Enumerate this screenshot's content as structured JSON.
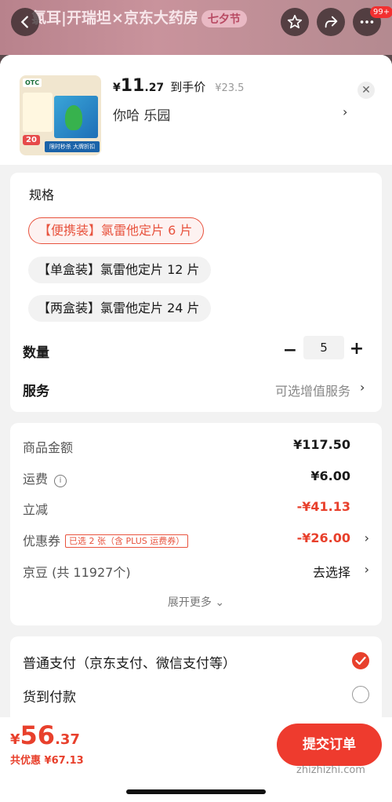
{
  "banner": {
    "text": "氯耳|开瑞坦×京东大药房",
    "badge": "七夕节",
    "notif_count": "99+"
  },
  "product": {
    "thumb": {
      "otc": "OTC",
      "promo_num": "20",
      "strip": "限时秒杀 大牌折扣"
    },
    "price_yen": "¥",
    "price_int": "11",
    "price_dec": ".27",
    "price_label": "到手价",
    "orig_price": "¥23.5",
    "variant": "你哈  乐园",
    "chevron": "›",
    "close": "✕"
  },
  "spec": {
    "title": "规格",
    "options": [
      {
        "label": "【便携装】氯雷他定片 6 片",
        "selected": true
      },
      {
        "label": "【单盒装】氯雷他定片 12 片",
        "selected": false
      },
      {
        "label": "【两盒装】氯雷他定片 24 片",
        "selected": false
      }
    ],
    "qty_label": "数量",
    "qty_minus": "−",
    "qty_value": "5",
    "qty_plus": "+",
    "service_label": "服务",
    "service_value": "可选增值服务",
    "chevron": "›"
  },
  "amounts": {
    "rows": [
      {
        "label": "商品金额",
        "value": "¥117.50"
      },
      {
        "label": "运费",
        "value": "¥6.00",
        "info": "i"
      },
      {
        "label": "立减",
        "value": "-¥41.13"
      },
      {
        "label": "优惠券",
        "value": "-¥26.00",
        "tag": "已选 2 张（含 PLUS 运费券）"
      },
      {
        "label": "京豆 (共 11927个)",
        "value": "去选择"
      }
    ],
    "chevron": "›",
    "expand": "展开更多 ⌄"
  },
  "payment": {
    "options": [
      {
        "label": "普通支付（京东支付、微信支付等）",
        "selected": true
      },
      {
        "label": "货到付款",
        "selected": false
      }
    ]
  },
  "footer": {
    "total_yen": "¥",
    "total_int": "56",
    "total_dec": ".37",
    "saved": "共优惠 ¥67.13",
    "submit": "提交订单",
    "watermark": "zhizhizhi.com"
  },
  "colors": {
    "accent": "#ee3b2e",
    "price_red": "#e8402c"
  }
}
